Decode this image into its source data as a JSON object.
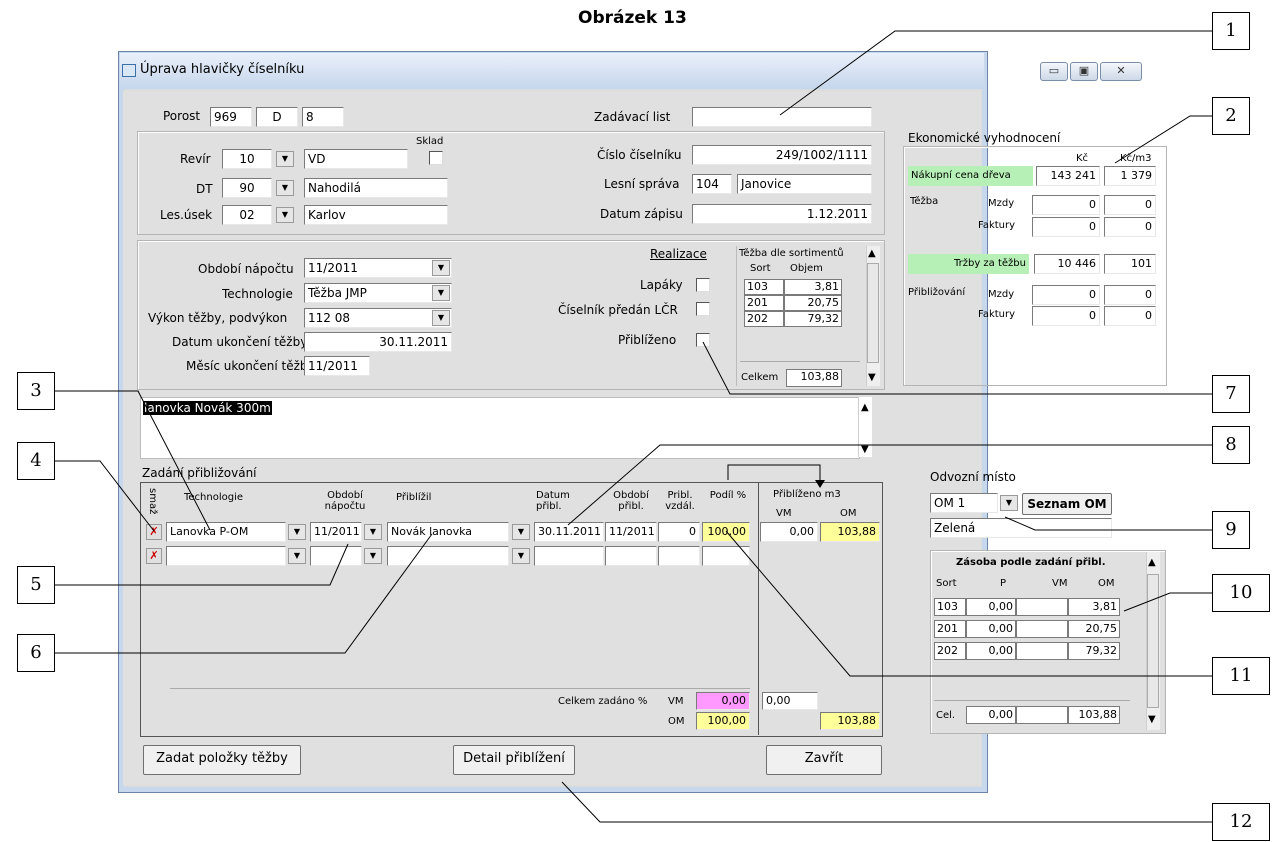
{
  "figure_title": "Obrázek 13",
  "window": {
    "title": "Úprava hlavičky číselníku",
    "controls": [
      "▭",
      "▣",
      "✕"
    ]
  },
  "header": {
    "porost_label": "Porost",
    "porost_values": [
      "969",
      "D",
      "8"
    ],
    "zadavaci_list_label": "Zadávací list",
    "zadavaci_list_value": "",
    "sklad_label": "Sklad",
    "revir_label": "Revír",
    "revir_code": "10",
    "revir_name": "VD",
    "dt_label": "DT",
    "dt_code": "90",
    "dt_name": "Nahodilá",
    "les_usek_label": "Les.úsek",
    "les_usek_code": "02",
    "les_usek_name": "Karlov",
    "cislo_ciselniku_label": "Číslo číselníku",
    "cislo_ciselniku_value": "249/1002/1111",
    "lesni_sprava_label": "Lesní správa",
    "lesni_sprava_code": "104",
    "lesni_sprava_name": "Janovice",
    "datum_zapisu_label": "Datum zápisu",
    "datum_zapisu_value": "1.12.2011"
  },
  "econ": {
    "title": "Ekonomické vyhodnocení",
    "col_kc": "Kč",
    "col_kcm3": "Kč/m3",
    "nakupni_label": "Nákupní cena dřeva",
    "nakupni_kc": "143 241",
    "nakupni_kcm3": "1 379",
    "tezba_label": "Těžba",
    "mzdy_label": "Mzdy",
    "faktury_label": "Faktury",
    "tezba_mzdy": [
      "0",
      "0"
    ],
    "tezba_faktury": [
      "0",
      "0"
    ],
    "trzby_label": "Tržby za těžbu",
    "trzby_kc": "10 446",
    "trzby_kcm3": "101",
    "priblizovani_label": "Přibližování",
    "pribl_mzdy": [
      "0",
      "0"
    ],
    "pribl_faktury": [
      "0",
      "0"
    ]
  },
  "middle": {
    "obdobi_label": "Období nápočtu",
    "obdobi_value": "11/2011",
    "technologie_label": "Technologie",
    "technologie_value": "Těžba JMP",
    "vykon_label": "Výkon těžby, podvýkon",
    "vykon_value": "112 08",
    "datum_ukonceni_label": "Datum ukončení těžby",
    "datum_ukonceni_value": "30.11.2011",
    "mesic_ukonceni_label": "Měsíc ukončení těžby",
    "mesic_ukonceni_value": "11/2011",
    "realizace_label": "Realizace",
    "lapaky_label": "Lapáky",
    "predan_label": "Číselník předán LČR",
    "priblizeno_label": "Přiblíženo"
  },
  "tezba_sortiment": {
    "title": "Těžba dle sortimentů",
    "col_sort": "Sort",
    "col_objem": "Objem",
    "rows": [
      {
        "sort": "103",
        "objem": "3,81"
      },
      {
        "sort": "201",
        "objem": "20,75"
      },
      {
        "sort": "202",
        "objem": "79,32"
      }
    ],
    "celkem_label": "Celkem",
    "celkem_value": "103,88"
  },
  "note_text": "lanovka Novák 300m",
  "zadani": {
    "title": "Zadání přibližování",
    "col_smaz": "smaž",
    "col_technologie": "Technologie",
    "col_obdobi": "Období nápočtu",
    "col_priblizil": "Přiblížil",
    "col_datum": "Datum přibl.",
    "col_obdobi_pribl": "Období přibl.",
    "col_vzdal": "Pribl. vzdál.",
    "col_podil": "Podíl %",
    "col_priblizeno": "Přiblíženo m3",
    "col_vm": "VM",
    "col_om": "OM",
    "row1": {
      "technologie": "Lanovka P-OM",
      "obdobi": "11/2011",
      "priblizil": "Novák lanovka",
      "datum": "30.11.2011",
      "obdobi_pribl": "11/2011",
      "vzdal": "0",
      "podil": "100,00",
      "vm": "0,00",
      "om": "103,88"
    },
    "celkem_label": "Celkem zadáno %",
    "vm_label": "VM",
    "om_label": "OM",
    "celkem_vm": "0,00",
    "celkem_om": "100,00",
    "celkem_m3_vm": "0,00",
    "celkem_m3_om": "103,88"
  },
  "odvozni": {
    "label": "Odvozní místo",
    "value": "OM 1",
    "seznam_button": "Seznam OM",
    "name": "Zelená"
  },
  "zasoba": {
    "title": "Zásoba podle zadání přibl.",
    "col_sort": "Sort",
    "col_p": "P",
    "col_vm": "VM",
    "col_om": "OM",
    "rows": [
      {
        "sort": "103",
        "p": "0,00",
        "vm": "",
        "om": "3,81"
      },
      {
        "sort": "201",
        "p": "0,00",
        "vm": "",
        "om": "20,75"
      },
      {
        "sort": "202",
        "p": "0,00",
        "vm": "",
        "om": "79,32"
      }
    ],
    "cel_label": "Cel.",
    "cel_p": "0,00",
    "cel_vm": "",
    "cel_om": "103,88"
  },
  "buttons": {
    "zadat": "Zadat položky těžby",
    "detail": "Detail přiblížení",
    "zavrit": "Zavřít"
  },
  "callouts": [
    "1",
    "2",
    "3",
    "4",
    "5",
    "6",
    "7",
    "8",
    "9",
    "10",
    "11",
    "12"
  ]
}
